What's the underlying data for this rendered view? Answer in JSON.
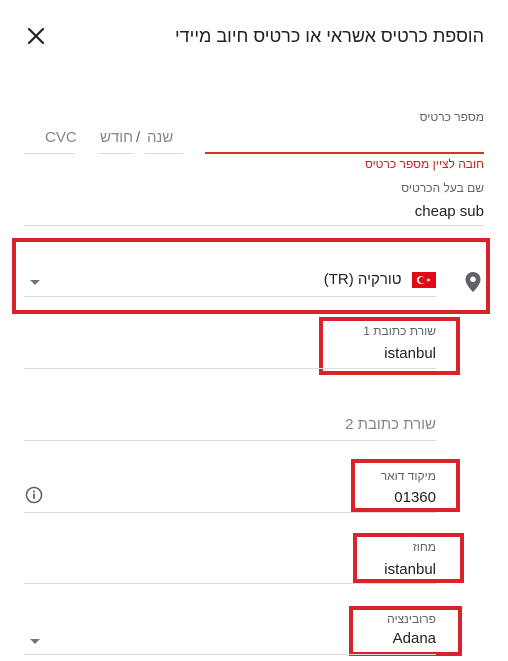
{
  "dialog": {
    "title": "הוספת כרטיס אשראי או כרטיס חיוב מיידי",
    "close_icon": "close-icon"
  },
  "card": {
    "number_label": "מספר כרטיס",
    "number_value": "",
    "number_error": "חובה לציין מספר כרטיס",
    "month_placeholder": "חודש",
    "separator": "/",
    "year_placeholder": "שנה",
    "cvc_placeholder": "CVC"
  },
  "cardholder": {
    "label": "שם בעל הכרטיס",
    "value": "cheap sub"
  },
  "country": {
    "value": "טורקיה (TR)",
    "flag_icon": "turkey-flag-icon",
    "location_icon": "location-pin-icon"
  },
  "address1": {
    "label": "שורת כתובת 1",
    "value": "istanbul"
  },
  "address2": {
    "placeholder": "שורת כתובת 2"
  },
  "postal": {
    "label": "מיקוד דואר",
    "value": "01360",
    "info_icon": "info-icon"
  },
  "district": {
    "label": "מחוז",
    "value": "istanbul"
  },
  "province": {
    "label": "פרובינציה",
    "value": "Adana"
  },
  "colors": {
    "error": "#d93025",
    "highlight": "#d8232a",
    "divider": "#dadce0"
  }
}
